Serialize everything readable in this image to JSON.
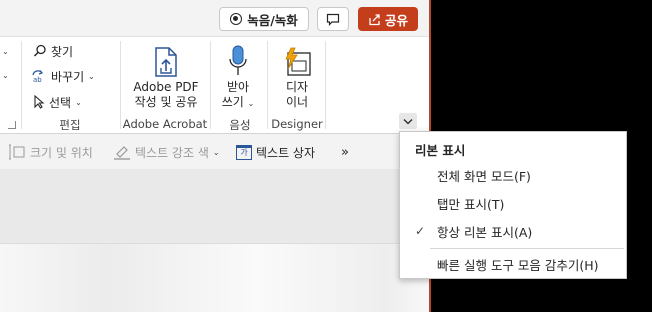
{
  "titlebar": {
    "record_label": "녹음/녹화",
    "share_label": "공유"
  },
  "ribbon": {
    "find_label": "찾기",
    "replace_label": "바꾸기",
    "select_label": "선택",
    "editing_group": "편집",
    "adobe_pdf_line1": "Adobe PDF",
    "adobe_pdf_line2": "작성 및 공유",
    "adobe_group": "Adobe Acrobat",
    "dictate_line1": "받아",
    "dictate_line2": "쓰기",
    "voice_group": "음성",
    "designer_line1": "디자",
    "designer_line2": "이너",
    "designer_group": "Designer"
  },
  "format_toolbar": {
    "size_position": "크기 및 위치",
    "text_highlight": "텍스트 강조 색",
    "textbox_icon_text": "가",
    "text_box": "텍스트 상자",
    "more": "»"
  },
  "ribbon_menu": {
    "header": "리본 표시",
    "items": [
      {
        "label": "전체 화면 모드(F)",
        "checked": false
      },
      {
        "label": "탭만 표시(T)",
        "checked": false
      },
      {
        "label": "항상 리본 표시(A)",
        "checked": true
      },
      {
        "label": "빠른 실행 도구 모음 감추기(H)",
        "checked": false
      }
    ],
    "check_glyph": "✓"
  },
  "colors": {
    "accent": "#c43e1c",
    "ribbon_bg": "#ffffff",
    "chrome_bg": "#f3f3f3",
    "icon_blue": "#2b579a",
    "designer_orange": "#f0a30a"
  }
}
